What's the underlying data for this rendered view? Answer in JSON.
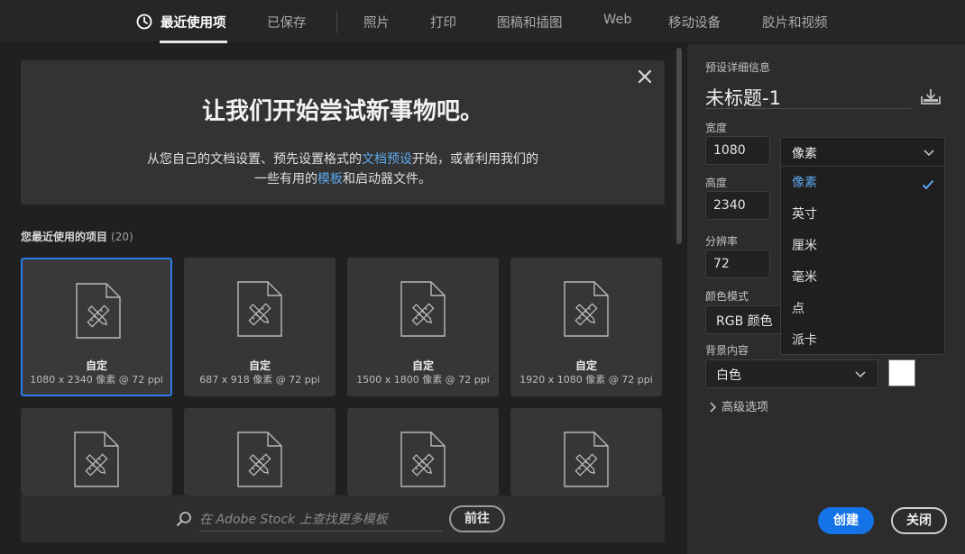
{
  "tabs": [
    {
      "label": "最近使用项",
      "active": true
    },
    {
      "label": "已保存"
    },
    {
      "label": "照片"
    },
    {
      "label": "打印"
    },
    {
      "label": "图稿和插图"
    },
    {
      "label": "Web"
    },
    {
      "label": "移动设备"
    },
    {
      "label": "胶片和视频"
    }
  ],
  "welcome": {
    "title": "让我们开始尝试新事物吧。",
    "line1_a": "从您自己的文档设置、预先设置格式的",
    "line1_link": "文档预设",
    "line1_b": "开始，或者利用我们的",
    "line2_a": "一些有用的",
    "line2_link": "模板",
    "line2_b": "和启动器文件。"
  },
  "recent": {
    "title": "您最近使用的项目",
    "count": "(20)",
    "items": [
      {
        "title": "自定",
        "size": "1080 x 2340 像素 @ 72 ppi",
        "selected": true
      },
      {
        "title": "自定",
        "size": "687 x 918 像素 @ 72 ppi"
      },
      {
        "title": "自定",
        "size": "1500 x 1800 像素 @ 72 ppi"
      },
      {
        "title": "自定",
        "size": "1920 x 1080 像素 @ 72 ppi"
      }
    ]
  },
  "search": {
    "placeholder": "在 Adobe Stock 上查找更多模板",
    "go_label": "前往"
  },
  "preset": {
    "header": "预设详细信息",
    "doc_name": "未标题-1",
    "width_label": "宽度",
    "width_value": "1080",
    "unit_selected": "像素",
    "height_label": "高度",
    "height_value": "2340",
    "resolution_label": "分辨率",
    "resolution_value": "72",
    "color_mode_label": "颜色模式",
    "color_mode_value": "RGB 颜色",
    "background_label": "背景内容",
    "background_value": "白色",
    "background_color": "#ffffff",
    "advanced_label": "高级选项",
    "create_label": "创建",
    "close_label": "关闭"
  },
  "unit_options": [
    "像素",
    "英寸",
    "厘米",
    "毫米",
    "点",
    "派卡"
  ],
  "accent_color": "#1473e6",
  "link_color": "#5fa8ec"
}
